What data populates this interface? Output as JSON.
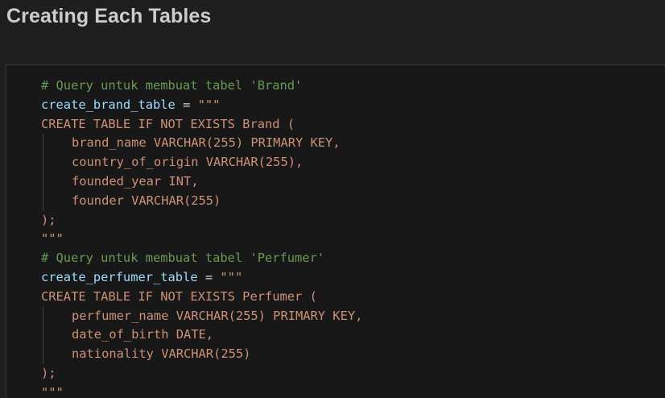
{
  "heading": "Creating Each Tables",
  "colors": {
    "background": "#1f1f1f",
    "cell_background": "#181818",
    "comment": "#6a9955",
    "variable": "#9cdcfe",
    "operator": "#d4d4d4",
    "string": "#ce9178",
    "heading_text": "#cccccc"
  },
  "code": {
    "brand_comment": "# Query untuk membuat tabel 'Brand'",
    "brand_var": "create_brand_table",
    "brand_eq": " = ",
    "brand_open_quotes": "\"\"\"",
    "brand_create": "CREATE TABLE IF NOT EXISTS Brand (",
    "brand_col1": "brand_name VARCHAR(255) PRIMARY KEY,",
    "brand_col2": "country_of_origin VARCHAR(255),",
    "brand_col3": "founded_year INT,",
    "brand_col4": "founder VARCHAR(255)",
    "brand_close": ");",
    "brand_close_quotes": "\"\"\"",
    "perfumer_comment": "# Query untuk membuat tabel 'Perfumer'",
    "perfumer_var": "create_perfumer_table",
    "perfumer_eq": " = ",
    "perfumer_open_quotes": "\"\"\"",
    "perfumer_create": "CREATE TABLE IF NOT EXISTS Perfumer (",
    "perfumer_col1": "perfumer_name VARCHAR(255) PRIMARY KEY,",
    "perfumer_col2": "date_of_birth DATE,",
    "perfumer_col3": "nationality VARCHAR(255)",
    "perfumer_close": ");",
    "perfumer_close_quotes": "\"\"\""
  }
}
